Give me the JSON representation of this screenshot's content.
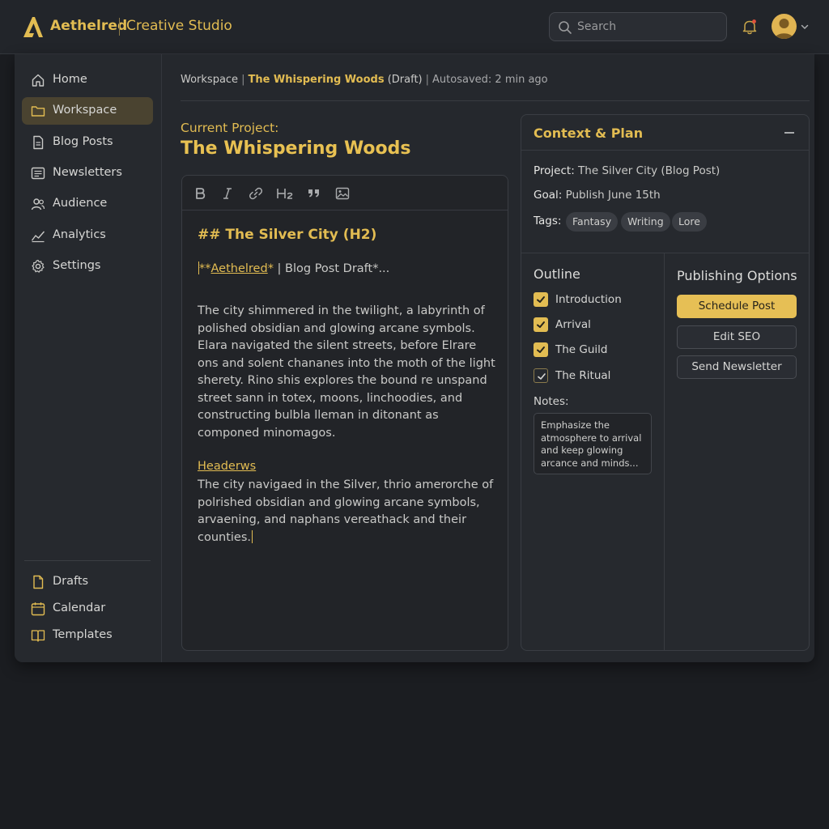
{
  "app": {
    "brand_name": "Aethelred",
    "brand_sub": "Creative Studio"
  },
  "header": {
    "search_placeholder": "Search"
  },
  "sidebar": {
    "items": [
      {
        "label": "Home",
        "icon": "home-icon"
      },
      {
        "label": "Workspace",
        "icon": "folder-icon",
        "active": true
      },
      {
        "label": "Blog Posts",
        "icon": "document-icon"
      },
      {
        "label": "Newsletters",
        "icon": "newsletter-icon"
      },
      {
        "label": "Audience",
        "icon": "users-icon"
      },
      {
        "label": "Analytics",
        "icon": "chart-icon"
      },
      {
        "label": "Settings",
        "icon": "gear-icon"
      }
    ],
    "bottom_items": [
      {
        "label": "Drafts",
        "icon": "file-icon"
      },
      {
        "label": "Calendar",
        "icon": "calendar-icon"
      },
      {
        "label": "Templates",
        "icon": "book-icon"
      }
    ]
  },
  "breadcrumb": {
    "root": "Workspace",
    "project": "The Whispering Woods",
    "status": "(Draft)",
    "autosave": "Autosaved: 2 min ago"
  },
  "project": {
    "label": "Current Project:",
    "title": "The Whispering Woods"
  },
  "editor": {
    "toolbar": [
      "B",
      "I",
      "link",
      "H2",
      "quote",
      "image"
    ],
    "heading": "## The Silver City (H2)",
    "meta_prefix": "**",
    "meta_link": "Aethelred",
    "meta_suffix": "*",
    "meta_rest": "Blog Post Draft*...",
    "paragraph1": "The city shimmered in the twilight, a labyrinth of polished obsidian and glowing arcane symbols. Elara navigated the silent streets, before Elrare ons and solent chananes into the moth of the light sherety. Rino shis explores the bound re unspand street sann in totex, moons, linchoodies, and constructing bulbla lleman in ditonant as componed minomagos.",
    "link": "Headerws",
    "paragraph2": "The city navigaed in the Silver, thrio amerorche of polrished obsidian and glowing arcane symbols, arvaening, and naphans vereathack and their counties."
  },
  "context": {
    "title": "Context & Plan",
    "project_label": "Project:",
    "project_value": "The Silver City (Blog Post)",
    "goal_label": "Goal:",
    "goal_value": "Publish June 15th",
    "tags_label": "Tags:",
    "tags": [
      "Fantasy",
      "Writing",
      "Lore"
    ],
    "outline_title": "Outline",
    "outline": [
      {
        "label": "Introduction",
        "checked": true
      },
      {
        "label": "Arrival",
        "checked": true
      },
      {
        "label": "The Guild",
        "checked": true
      },
      {
        "label": "The Ritual",
        "checked": true
      }
    ],
    "notes_label": "Notes:",
    "notes_value": "Emphasize the atmosphere to arrival and keep glowing arcance and minds...",
    "publishing_title": "Publishing Options",
    "buttons": {
      "schedule": "Schedule Post",
      "seo": "Edit SEO",
      "newsletter": "Send Newsletter"
    }
  },
  "colors": {
    "accent": "#e2bc52",
    "background": "#1b1d21",
    "panel": "#26292e"
  }
}
